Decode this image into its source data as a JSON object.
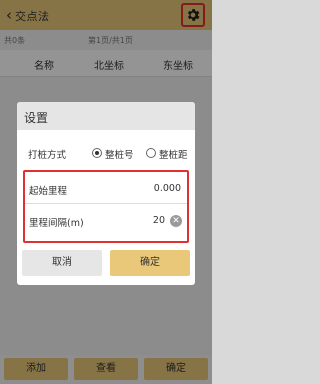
{
  "header": {
    "title": "交点法",
    "back_icon": "chevron-left-icon",
    "settings_icon": "gear-icon"
  },
  "pager": {
    "count": "共0条",
    "pages": "第1页/共1页"
  },
  "table": {
    "columns": [
      "名称",
      "北坐标",
      "东坐标"
    ]
  },
  "bottom_bar": {
    "buttons": [
      "添加",
      "查看",
      "确定"
    ]
  },
  "dialog": {
    "title": "设置",
    "stake_type": {
      "label": "打桩方式",
      "options": [
        "整桩号",
        "整桩距"
      ],
      "selected": "整桩号"
    },
    "start_mileage": {
      "label": "起始里程",
      "value": "0.000"
    },
    "mileage_interval": {
      "label": "里程间隔(m)",
      "value": "20"
    },
    "cancel_label": "取消",
    "ok_label": "确定"
  },
  "colors": {
    "accent": "#e9c979",
    "highlight_border": "#e03030"
  }
}
